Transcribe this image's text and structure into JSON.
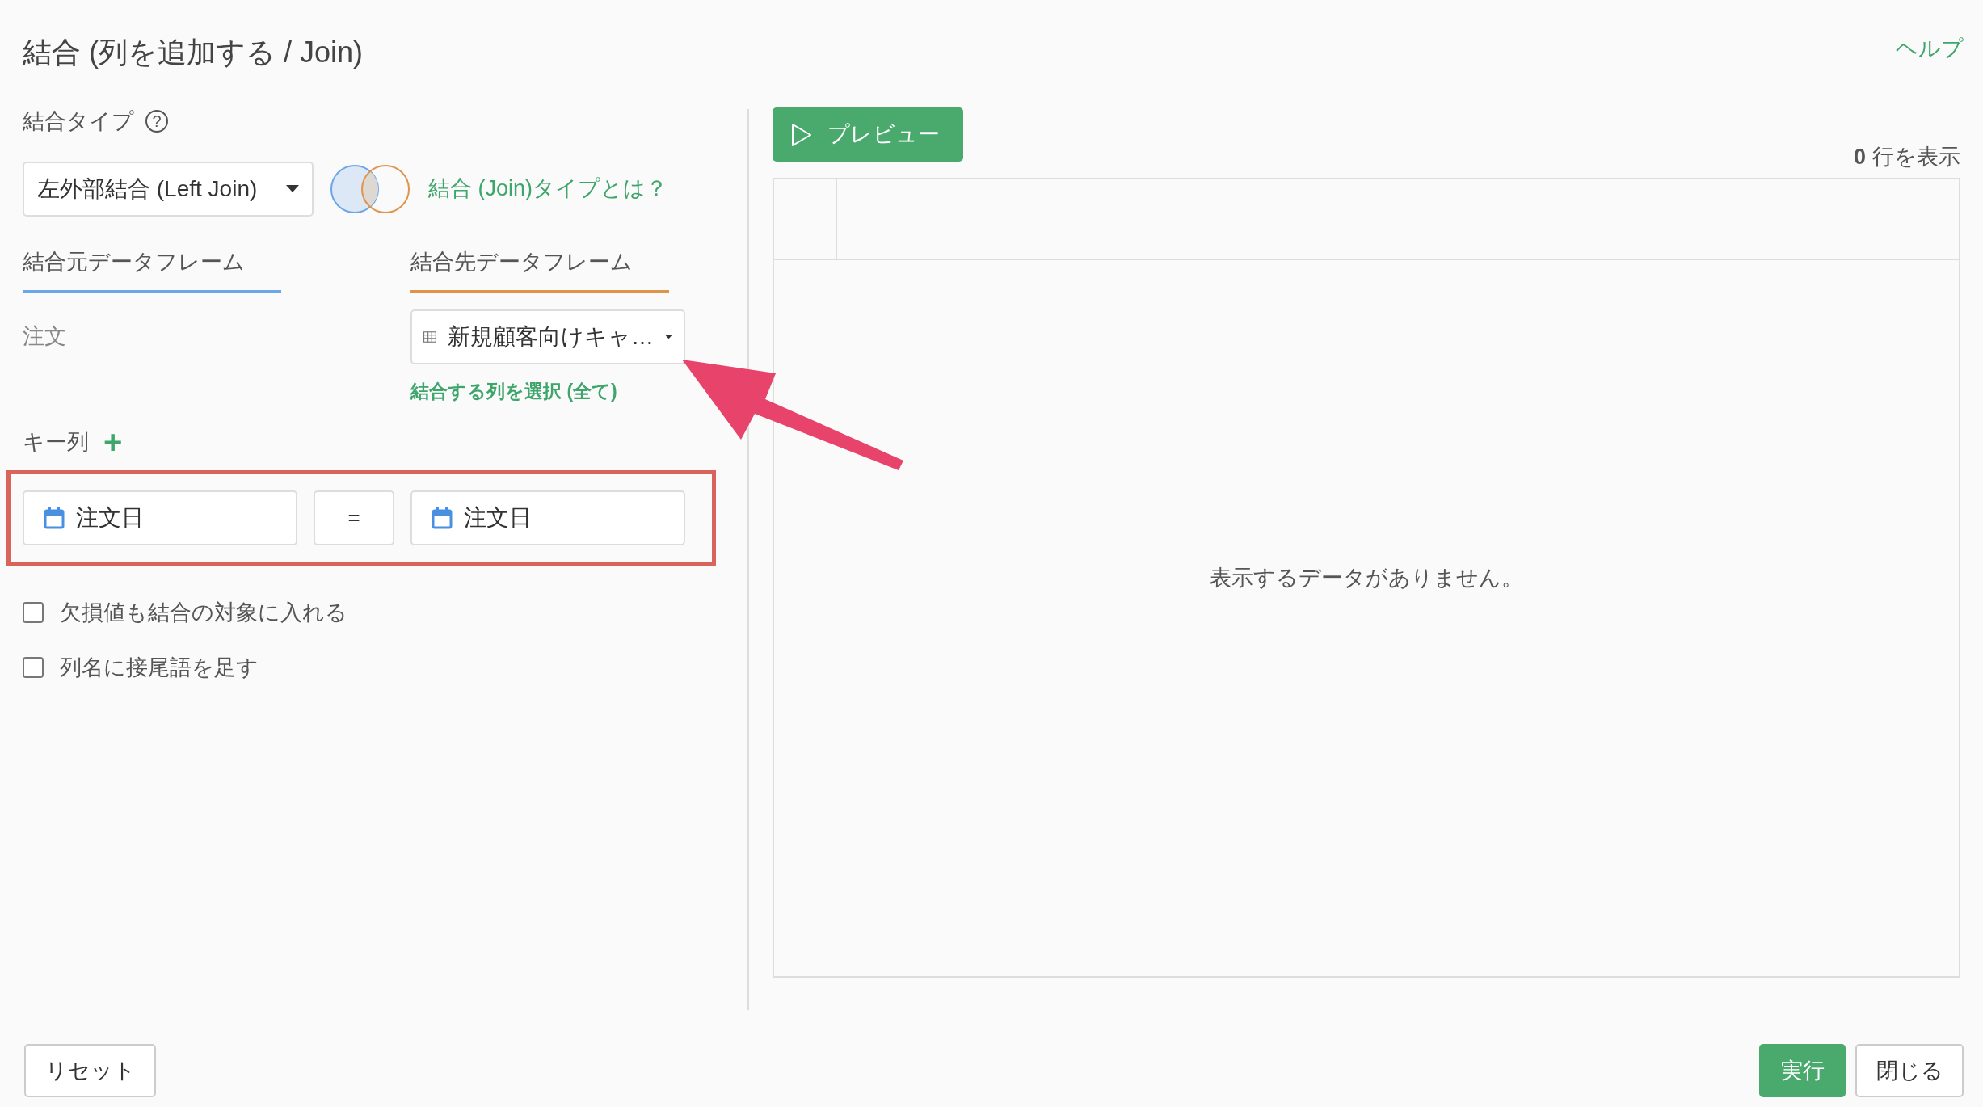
{
  "title": "結合 (列を追加する / Join)",
  "help_link": "ヘルプ",
  "join_type": {
    "label": "結合タイプ",
    "help": "?",
    "value": "左外部結合 (Left Join)",
    "link": "結合 (Join)タイプとは？"
  },
  "frames": [
    {
      "label": "結合元データフレーム",
      "color": "#6aa6e8",
      "value": "注文",
      "kind": "text"
    },
    {
      "label": "結合先データフレーム",
      "color": "#e0944a",
      "value": "新規顧客向けキャ…",
      "kind": "select"
    }
  ],
  "select_columns_link": "結合する列を選択 (全て)",
  "key_columns": {
    "label": "キー列",
    "add": "+",
    "left": "注文日",
    "operator": "=",
    "right": "注文日"
  },
  "options": [
    {
      "label": "欠損値も結合の対象に入れる",
      "checked": false
    },
    {
      "label": "列名に接尾語を足す",
      "checked": false
    }
  ],
  "preview": {
    "button": "プレビュー",
    "row_count": "0",
    "row_count_suffix": "行を表示",
    "empty_message": "表示するデータがありません。"
  },
  "footer": {
    "reset": "リセット",
    "run": "実行",
    "close": "閉じる"
  }
}
